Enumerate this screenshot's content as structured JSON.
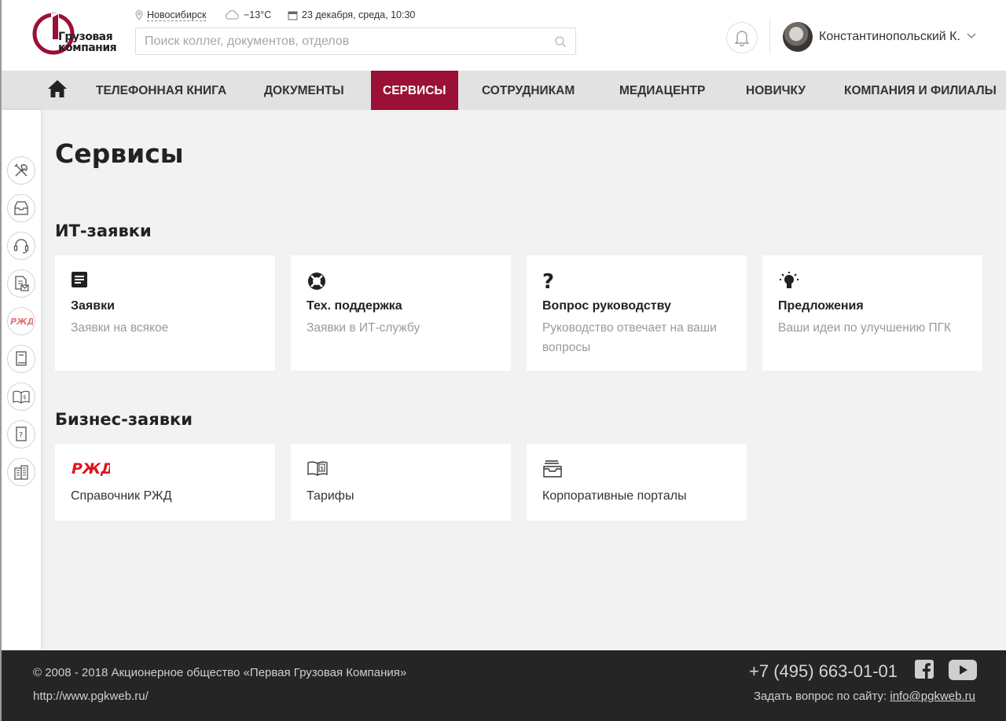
{
  "brand": {
    "logo_line1": "Грузовая",
    "logo_line2": "компания",
    "accent_color": "#9a1036"
  },
  "header": {
    "city": "Новосибирск",
    "weather": "−13°C",
    "date": "23 декабря, среда, 10:30",
    "search_placeholder": "Поиск коллег, документов, отделов",
    "user_name": "Константинопольский К."
  },
  "nav": {
    "items": [
      {
        "label": "ТЕЛЕФОННАЯ КНИГА",
        "active": false
      },
      {
        "label": "ДОКУМЕНТЫ",
        "active": false
      },
      {
        "label": "СЕРВИСЫ",
        "active": true
      },
      {
        "label": "СОТРУДНИКАМ",
        "active": false
      },
      {
        "label": "МЕДИАЦЕНТР",
        "active": false
      },
      {
        "label": "НОВИЧКУ",
        "active": false
      },
      {
        "label": "КОМПАНИЯ И ФИЛИАЛЫ",
        "active": false
      }
    ]
  },
  "sidebar": {
    "icons": [
      "tools-icon",
      "inbox-icon",
      "headset-icon",
      "document-mail-icon",
      "rzd-logo-icon",
      "book-icon",
      "tariff-book-icon",
      "question-doc-icon",
      "buildings-icon"
    ],
    "rzd_text": "РЖД"
  },
  "page": {
    "title": "Сервисы"
  },
  "it_section": {
    "title": "ИТ-заявки",
    "cards": [
      {
        "icon": "document-list-icon",
        "title": "Заявки",
        "desc": "Заявки на всякое"
      },
      {
        "icon": "lifebuoy-icon",
        "title": "Тех. поддержка",
        "desc": "Заявки в ИТ-службу"
      },
      {
        "icon": "question-icon",
        "title": "Вопрос руководству",
        "desc": "Руководство отвечает на ваши вопросы"
      },
      {
        "icon": "lightbulb-icon",
        "title": "Предложения",
        "desc": "Ваши идеи по улучшению ПГК"
      }
    ]
  },
  "business_section": {
    "title": "Бизнес-заявки",
    "cards": [
      {
        "icon": "rzd-logo-icon",
        "label": "Справочник РЖД"
      },
      {
        "icon": "tariff-book-icon",
        "label": "Тарифы"
      },
      {
        "icon": "inbox-icon",
        "label": "Корпоративные порталы"
      }
    ]
  },
  "footer": {
    "copyright": "© 2008 - 2018 Акционерное общество «Первая Грузовая Компания»",
    "url": "http://www.pgkweb.ru/",
    "phone": "+7 (495) 663-01-01",
    "ask_label": "Задать вопрос по сайту:",
    "email": "info@pgkweb.ru"
  }
}
